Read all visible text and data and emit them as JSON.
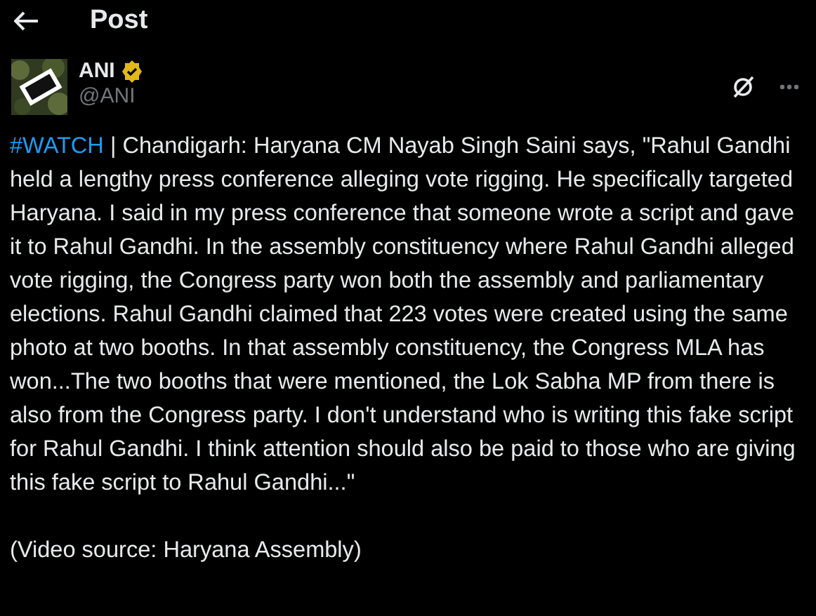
{
  "header": {
    "title": "Post"
  },
  "author": {
    "name": "ANI",
    "verified": true,
    "handle": "@ANI"
  },
  "post": {
    "hashtag": "#WATCH",
    "text": " | Chandigarh: Haryana CM Nayab Singh Saini says, \"Rahul Gandhi held a lengthy press conference alleging vote rigging. He specifically targeted Haryana. I said in my press conference that someone wrote a script and gave it to Rahul Gandhi. In the assembly constituency where Rahul Gandhi alleged vote rigging, the Congress party won both the assembly and parliamentary elections. Rahul Gandhi claimed that 223 votes were created using the same photo at two booths. In that assembly constituency, the Congress MLA has won...The two booths that were mentioned, the Lok Sabha MP from there is also from the Congress party. I don't understand who is writing this fake script for Rahul Gandhi. I think attention should also be paid to those who are giving this fake script to Rahul Gandhi...\"",
    "source": "(Video source: Haryana Assembly)"
  }
}
